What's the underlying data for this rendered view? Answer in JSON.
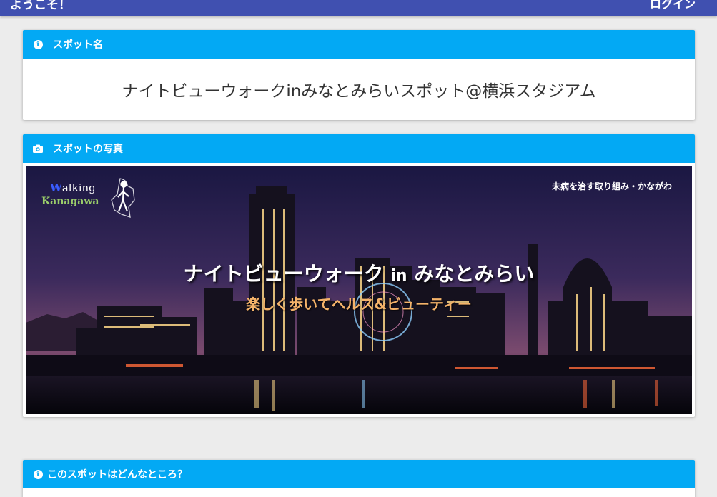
{
  "topbar": {
    "greeting": "ようこそ！",
    "login_label": "ログイン"
  },
  "spot_name_card": {
    "header_label": "スポット名",
    "header_icon": "info-icon",
    "spot_name": "ナイトビューウォークinみなとみらいスポット@横浜スタジアム"
  },
  "photo_card": {
    "header_label": "スポットの写真",
    "header_icon": "camera-icon",
    "banner": {
      "logo_walking_first": "W",
      "logo_walking_rest": "alking",
      "logo_kanagawa": "Kanagawa",
      "tagline": "未病を治す取り組み・かながわ",
      "title_part1": "ナイトビューウォーク ",
      "title_in": "in",
      "title_part2": " みなとみらい",
      "subtitle": "楽しく歩いてヘルス&ビューティー"
    }
  },
  "description_card": {
    "header_label": "このスポットはどんなところ？",
    "header_icon": "info-icon"
  },
  "colors": {
    "topbar": "#4050b0",
    "card_header": "#03a9f4",
    "background": "#ececec"
  }
}
